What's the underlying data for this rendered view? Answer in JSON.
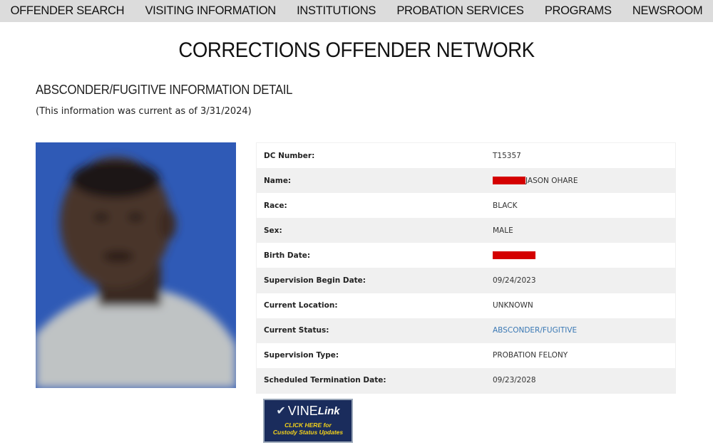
{
  "nav": {
    "items": [
      {
        "label": "OFFENDER SEARCH"
      },
      {
        "label": "VISITING INFORMATION"
      },
      {
        "label": "INSTITUTIONS"
      },
      {
        "label": "PROBATION SERVICES"
      },
      {
        "label": "PROGRAMS"
      },
      {
        "label": "NEWSROOM"
      }
    ]
  },
  "page": {
    "title": "CORRECTIONS OFFENDER NETWORK",
    "section_heading": "ABSCONDER/FUGITIVE INFORMATION DETAIL",
    "current_note": "(This information was current as of 3/31/2024)"
  },
  "photo": {
    "icon": "offender-photo",
    "background_color": "#2f5ab6"
  },
  "details": {
    "rows": [
      {
        "label": "DC Number:",
        "value": "T15357"
      },
      {
        "label": "Name:",
        "value": "JASON OHARE"
      },
      {
        "label": "Race:",
        "value": "BLACK"
      },
      {
        "label": "Sex:",
        "value": "MALE"
      },
      {
        "label": "Birth Date:",
        "value": ""
      },
      {
        "label": "Supervision Begin Date:",
        "value": "09/24/2023"
      },
      {
        "label": "Current Location:",
        "value": "UNKNOWN"
      },
      {
        "label": "Current Status:",
        "value": "ABSCONDER/FUGITIVE"
      },
      {
        "label": "Supervision Type:",
        "value": "PROBATION FELONY"
      },
      {
        "label": "Scheduled Termination Date:",
        "value": "09/23/2028"
      }
    ]
  },
  "colors": {
    "redaction": "#d40000",
    "link": "#3a78b4",
    "nav_bg": "#dcdcdc"
  },
  "vinelink": {
    "brand_vine": "VINE",
    "brand_link": "Link",
    "cta_line1": "CLICK HERE for",
    "cta_line2": "Custody Status Updates"
  }
}
